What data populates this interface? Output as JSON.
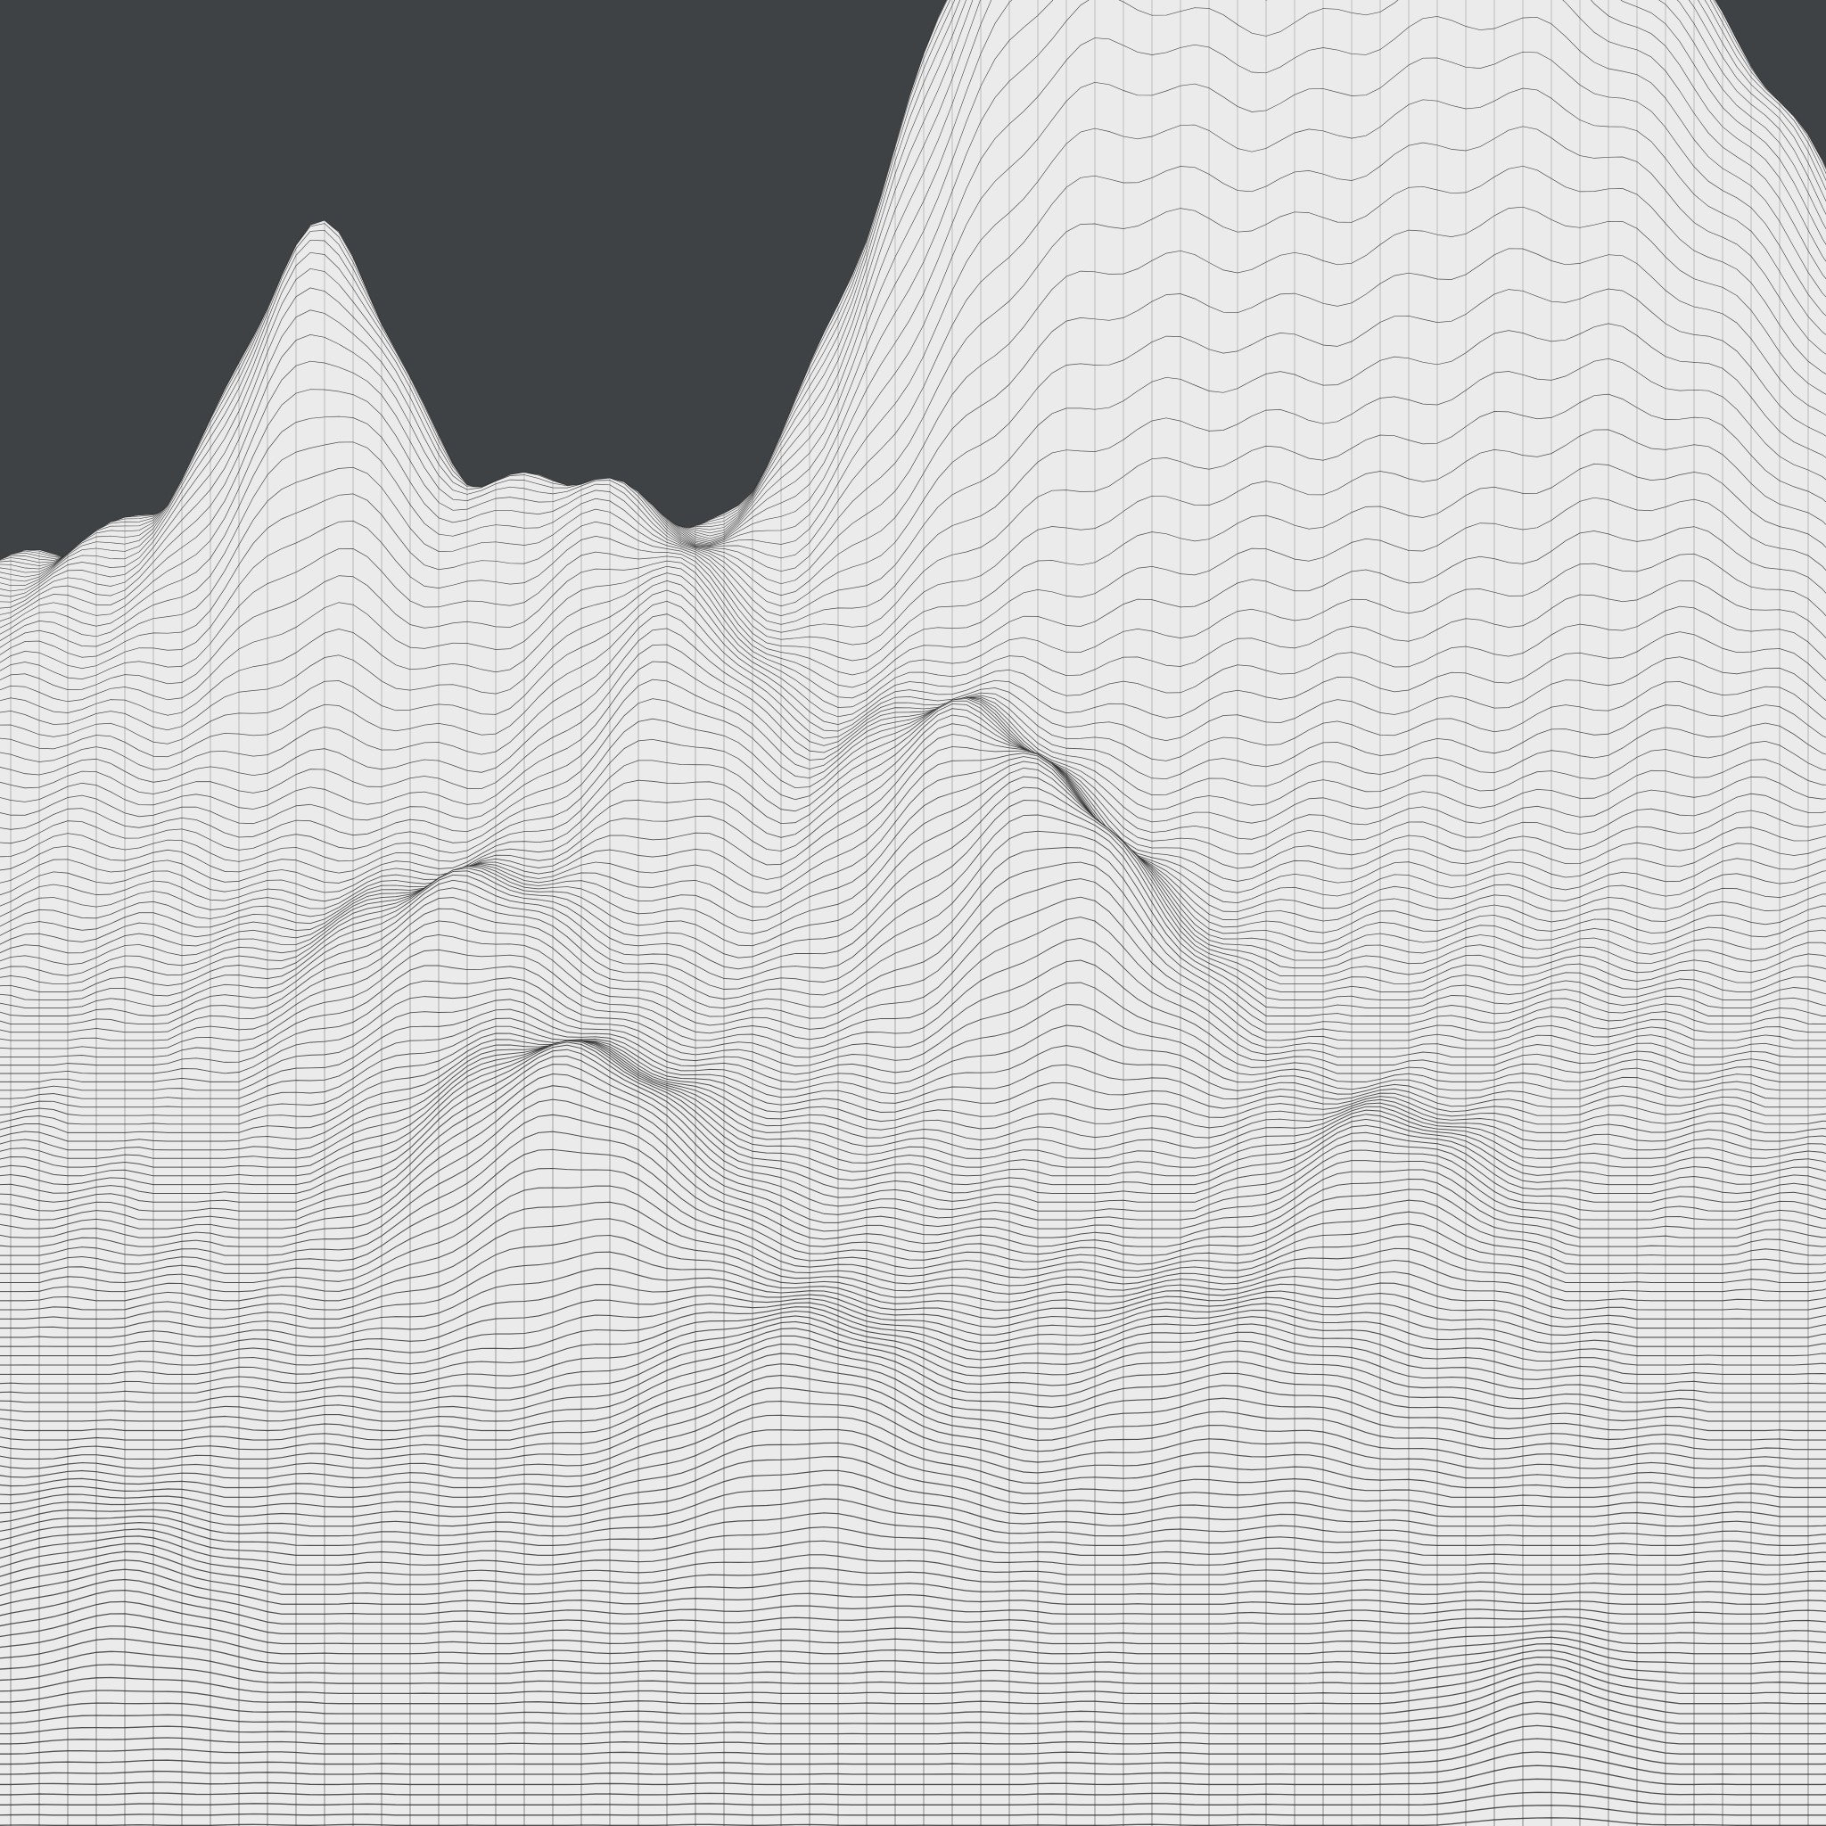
{
  "scene": {
    "background_color": "#3e4245",
    "surface_color": "#ebebeb",
    "wire_color": "#1c1c1c"
  }
}
